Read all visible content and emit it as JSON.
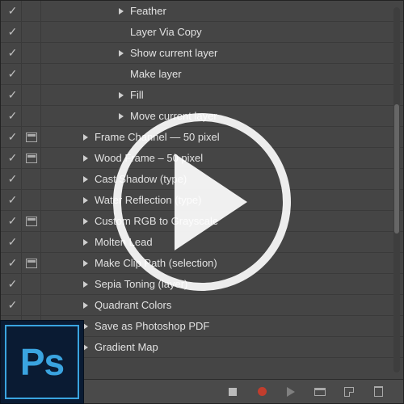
{
  "actions": {
    "items": [
      {
        "label": "Feather",
        "indent": 2,
        "hasTri": true,
        "hasDialog": false,
        "checked": true
      },
      {
        "label": "Layer Via Copy",
        "indent": 2,
        "hasTri": false,
        "hasDialog": false,
        "checked": true
      },
      {
        "label": "Show current layer",
        "indent": 2,
        "hasTri": true,
        "hasDialog": false,
        "checked": true
      },
      {
        "label": "Make layer",
        "indent": 2,
        "hasTri": false,
        "hasDialog": false,
        "checked": true
      },
      {
        "label": "Fill",
        "indent": 2,
        "hasTri": true,
        "hasDialog": false,
        "checked": true
      },
      {
        "label": "Move current layer",
        "indent": 2,
        "hasTri": true,
        "hasDialog": false,
        "checked": true
      },
      {
        "label": "Frame Channel — 50 pixel",
        "indent": 1,
        "hasTri": true,
        "hasDialog": true,
        "checked": true
      },
      {
        "label": "Wood Frame – 50 pixel",
        "indent": 1,
        "hasTri": true,
        "hasDialog": true,
        "checked": true
      },
      {
        "label": "Cast Shadow (type)",
        "indent": 1,
        "hasTri": true,
        "hasDialog": false,
        "checked": true
      },
      {
        "label": "Water Reflection (type)",
        "indent": 1,
        "hasTri": true,
        "hasDialog": false,
        "checked": true
      },
      {
        "label": "Custom RGB to Grayscale",
        "indent": 1,
        "hasTri": true,
        "hasDialog": true,
        "checked": true
      },
      {
        "label": "Molten Lead",
        "indent": 1,
        "hasTri": true,
        "hasDialog": false,
        "checked": true
      },
      {
        "label": "Make Clip Path (selection)",
        "indent": 1,
        "hasTri": true,
        "hasDialog": true,
        "checked": true
      },
      {
        "label": "Sepia Toning (layer)",
        "indent": 1,
        "hasTri": true,
        "hasDialog": false,
        "checked": true
      },
      {
        "label": "Quadrant Colors",
        "indent": 1,
        "hasTri": true,
        "hasDialog": false,
        "checked": true
      },
      {
        "label": "Save as Photoshop PDF",
        "indent": 1,
        "hasTri": true,
        "hasDialog": true,
        "checked": true
      },
      {
        "label": "Gradient Map",
        "indent": 1,
        "hasTri": true,
        "hasDialog": false,
        "checked": true
      }
    ]
  },
  "toolbar": {
    "stop": "Stop",
    "record": "Record",
    "play": "Play",
    "newSet": "New Set",
    "newAction": "New Action",
    "delete": "Delete"
  },
  "badge": {
    "text": "Ps"
  }
}
